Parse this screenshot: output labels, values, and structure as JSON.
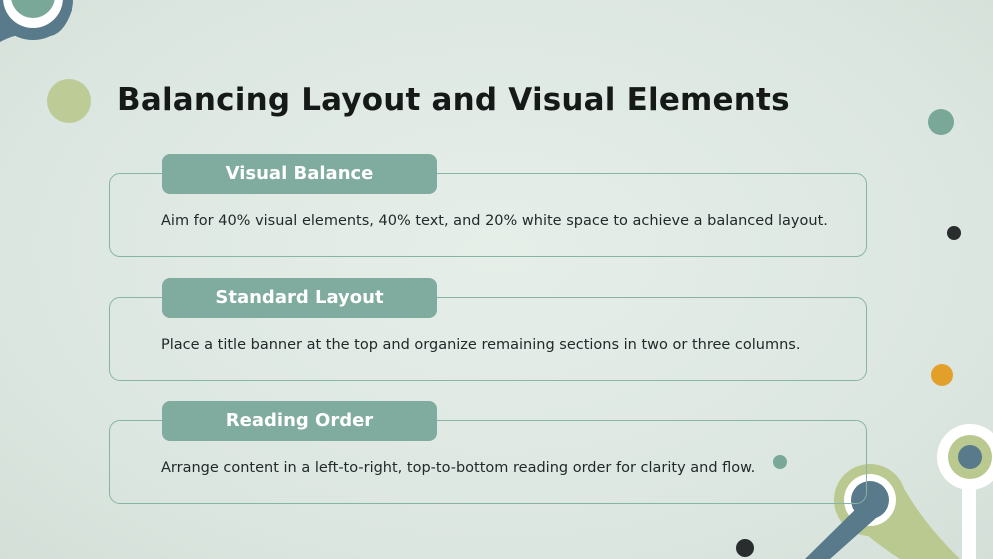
{
  "title": "Balancing Layout and Visual Elements",
  "cards": [
    {
      "heading": "Visual Balance",
      "text": "Aim for 40% visual elements, 40% text, and 20% white space to achieve a balanced layout."
    },
    {
      "heading": "Standard Layout",
      "text": "Place a title banner at the top and organize remaining sections in two or three columns."
    },
    {
      "heading": "Reading Order",
      "text": "Arrange content in a left-to-right, top-to-bottom reading order for clarity and flow."
    }
  ],
  "colors": {
    "background": "#dfe8e3",
    "tab": "#7fac9e",
    "card_border": "#86b4a6",
    "title": "#151a18",
    "accent_green": "#b9c98f",
    "accent_teal": "#79a899",
    "accent_slate": "#587a8b",
    "accent_orange": "#e2a02b",
    "accent_dark": "#2a2d2e"
  }
}
